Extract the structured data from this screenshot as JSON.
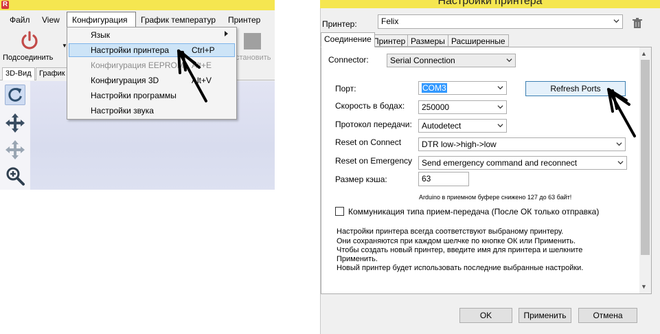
{
  "app": {
    "logo_letter": "R",
    "menu": {
      "file": "Файл",
      "view": "View",
      "config": "Конфигурация",
      "temp_graph": "График температур",
      "printer": "Принтер"
    },
    "toolbar": {
      "connect_label": "Подсоединить",
      "stop_label": "становить"
    },
    "tabs": {
      "view3d": "3D-Вид",
      "graph": "График"
    },
    "dropdown": {
      "items": [
        {
          "label": "Язык",
          "shortcut": ""
        },
        {
          "label": "Настройки принтера",
          "shortcut": "Ctrl+P"
        },
        {
          "label": "Конфигурация EEPROM",
          "shortcut": "Alt+E"
        },
        {
          "label": "Конфигурация 3D",
          "shortcut": "Alt+V"
        },
        {
          "label": "Настройки программы",
          "shortcut": ""
        },
        {
          "label": "Настройки звука",
          "shortcut": ""
        }
      ]
    },
    "colors": {
      "titlebar": "#f5e650",
      "power_icon": "#c24a48",
      "highlight": "#cde4f7"
    }
  },
  "dialog": {
    "title": "Настройки принтера",
    "printer_label": "Принтер:",
    "printer_value": "Felix",
    "tabs": [
      "Соединение",
      "Принтер",
      "Размеры",
      "Расширенные"
    ],
    "connector_label": "Connector:",
    "connector_value": "Serial Connection",
    "port_label": "Порт:",
    "port_value": "COM3",
    "refresh_button": "Refresh Ports",
    "baud_label": "Скорость в бодах:",
    "baud_value": "250000",
    "protocol_label": "Протокол передачи:",
    "protocol_value": "Autodetect",
    "reset_connect_label": "Reset on Connect",
    "reset_connect_value": "DTR low->high->low",
    "reset_emergency_label": "Reset on Emergency",
    "reset_emergency_value": "Send emergency command and reconnect",
    "cache_label": "Размер кэша:",
    "cache_value": "63",
    "cache_note": "Arduino в приемном буфере снижено 127 до 63 байт!",
    "pingpong_label": "Коммуникация типа прием-передача (После ОК только отправка)",
    "pingpong_checked": false,
    "info_lines": [
      "Настройки принтера всегда соответствуют выбраному принтеру.",
      "Они сохраняются при каждом шелчке по кнопке ОК или Применить.",
      "Чтобы создать новый принтер, введите имя для принтера и шелкните",
      "Применить.",
      "Новый принтер будет использовать последние выбранные настройки."
    ],
    "buttons": {
      "ok": "OK",
      "apply": "Применить",
      "cancel": "Отмена"
    }
  }
}
